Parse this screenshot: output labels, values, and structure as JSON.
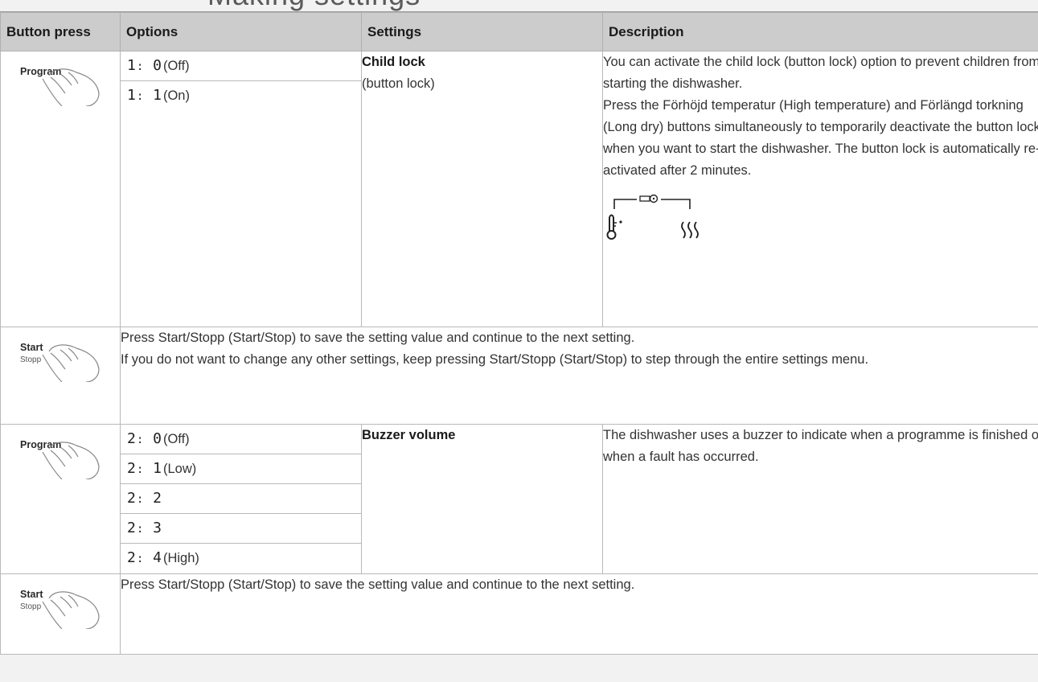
{
  "page_title": "Making settings",
  "columns": [
    "Button press",
    "Options",
    "Settings",
    "Description"
  ],
  "buttons": {
    "program": "Program",
    "start": "Start",
    "stop": "Stopp"
  },
  "child_lock": {
    "options": [
      {
        "code": "1",
        "value": "0",
        "label": "(Off)"
      },
      {
        "code": "1",
        "value": "1",
        "label": "(On)"
      }
    ],
    "setting_title": "Child lock",
    "setting_sub": "(button lock)",
    "desc_1": "You can activate the child lock (button lock) option to prevent children from starting the dishwasher.",
    "desc_2": "Press the Förhöjd temperatur (High temperature) and Förlängd torkning (Long dry) buttons simultaneously to temporarily deactivate the button lock when you want to start the dishwasher. The button lock is automatically re-activated after 2 minutes.",
    "diagram_icons": [
      "thermometer-icon",
      "key-icon",
      "steam-icon"
    ]
  },
  "start_row_1": {
    "line_1": "Press Start/Stopp (Start/Stop) to save the setting value and continue to the next setting.",
    "line_2": "If you do not want to change any other settings, keep pressing Start/Stopp (Start/Stop) to step through the entire settings menu."
  },
  "buzzer": {
    "options": [
      {
        "code": "2",
        "value": "0",
        "label": "(Off)"
      },
      {
        "code": "2",
        "value": "1",
        "label": "(Low)"
      },
      {
        "code": "2",
        "value": "2",
        "label": ""
      },
      {
        "code": "2",
        "value": "3",
        "label": ""
      },
      {
        "code": "2",
        "value": "4",
        "label": "(High)"
      }
    ],
    "setting_title": "Buzzer volume",
    "desc": "The dishwasher uses a buzzer to indicate when a programme is finished or when a fault has occurred."
  },
  "start_row_2": {
    "line_1": "Press Start/Stopp (Start/Stop) to save the setting value and continue to the next setting."
  }
}
